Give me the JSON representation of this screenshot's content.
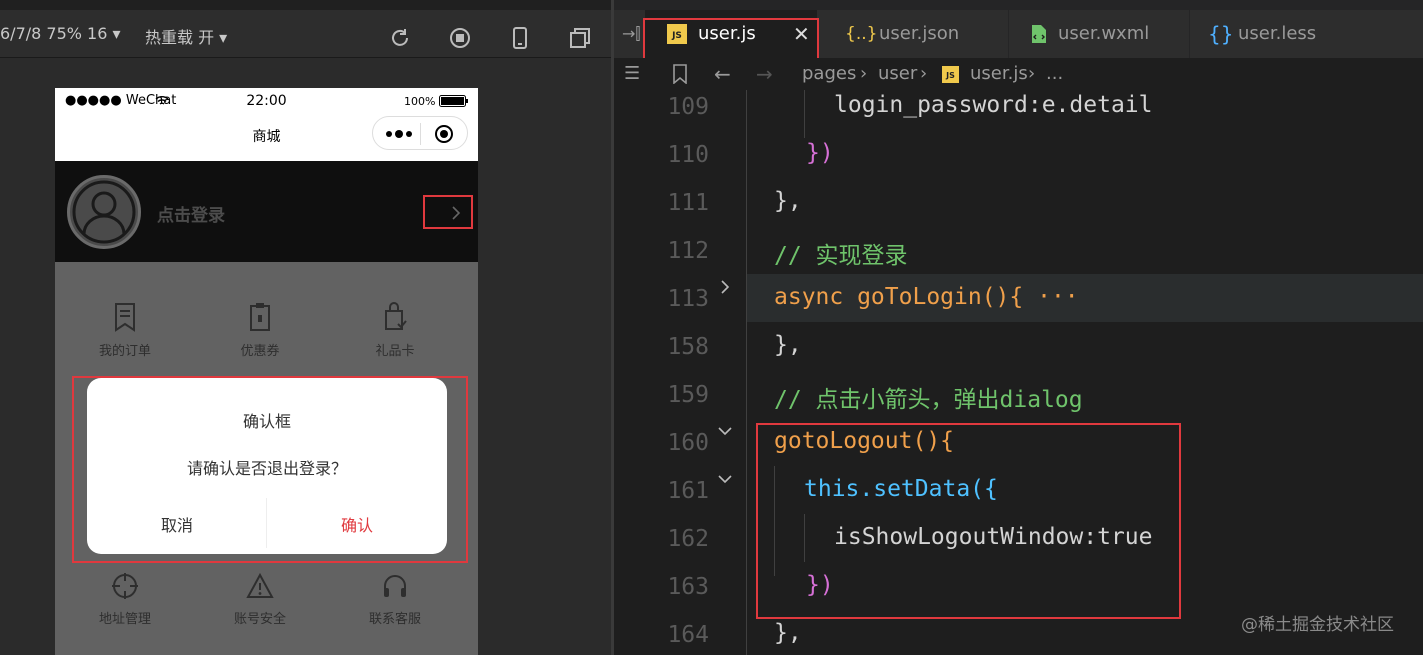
{
  "simulator": {
    "toolbar": {
      "device_info": "6/7/8 75% 16",
      "hot_reload": "热重载 开"
    },
    "statusbar": {
      "carrier": "●●●●● WeChat",
      "time": "22:00",
      "battery": "100%"
    },
    "navbar": {
      "title": "商城"
    },
    "user_header": {
      "login_text": "点击登录"
    },
    "grid_row1": [
      {
        "label": "我的订单",
        "icon": "order-icon"
      },
      {
        "label": "优惠券",
        "icon": "coupon-icon"
      },
      {
        "label": "礼品卡",
        "icon": "gift-card-icon"
      }
    ],
    "grid_row2": [
      {
        "label": "地址管理",
        "icon": "address-icon"
      },
      {
        "label": "账号安全",
        "icon": "warning-icon"
      },
      {
        "label": "联系客服",
        "icon": "headset-icon"
      }
    ],
    "dialog": {
      "title": "确认框",
      "message": "请确认是否退出登录？",
      "cancel": "取消",
      "confirm": "确认"
    }
  },
  "editor": {
    "tabs": [
      {
        "label": "user.js",
        "icon": "js-file-icon",
        "active": true
      },
      {
        "label": "user.json",
        "icon": "json-file-icon",
        "active": false
      },
      {
        "label": "user.wxml",
        "icon": "wxml-file-icon",
        "active": false
      },
      {
        "label": "user.less",
        "icon": "less-file-icon",
        "active": false
      }
    ],
    "breadcrumb": {
      "part1": "pages",
      "part2": "user",
      "part3": "user.js",
      "more": "..."
    },
    "lines": [
      {
        "num": "109",
        "text": "login_password:e.detail"
      },
      {
        "num": "110",
        "text": "})"
      },
      {
        "num": "111",
        "text": "},"
      },
      {
        "num": "112",
        "text": "// 实现登录"
      },
      {
        "num": "113",
        "text": "async goToLogin(){ ···"
      },
      {
        "num": "158",
        "text": "},"
      },
      {
        "num": "159",
        "text": "// 点击小箭头，弹出dialog"
      },
      {
        "num": "160",
        "text": "gotoLogout(){"
      },
      {
        "num": "161",
        "text": "this.setData({"
      },
      {
        "num": "162",
        "text": "isShowLogoutWindow:true"
      },
      {
        "num": "163",
        "text": "})"
      },
      {
        "num": "164",
        "text": "},"
      }
    ],
    "watermark": "@稀土掘金技术社区"
  },
  "colors": {
    "highlight_red": "#e0393e",
    "keyword": "#f0c94c",
    "function": "#f0a04b",
    "comment": "#6fc36b",
    "this": "#4fc1ff"
  }
}
